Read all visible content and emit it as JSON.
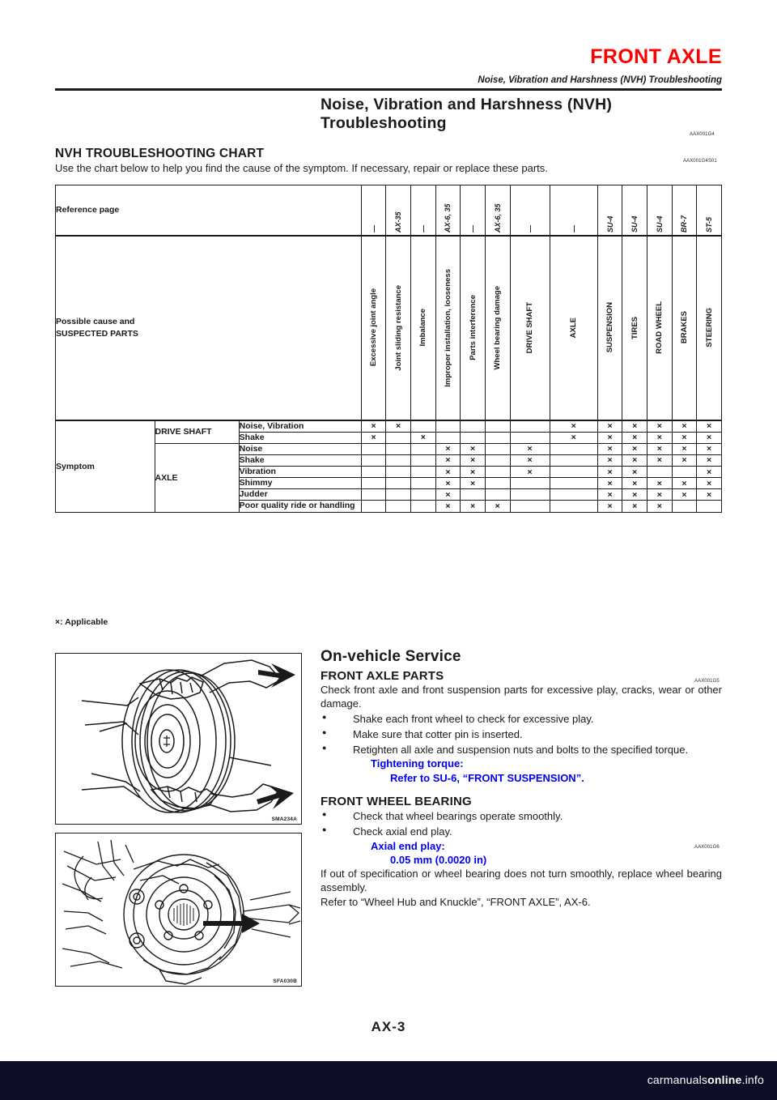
{
  "header": {
    "title": "FRONT AXLE",
    "subtitle": "Noise, Vibration and Harshness (NVH) Troubleshooting",
    "title_color": "#ff0000"
  },
  "section": {
    "title": "Noise, Vibration and Harshness (NVH) Troubleshooting",
    "code": "AAX001G4",
    "chart_heading": "NVH TROUBLESHOOTING CHART",
    "chart_code": "AAX001G4S01",
    "intro": "Use the chart below to help you find the cause of the symptom. If necessary, repair or replace these parts."
  },
  "nvh_table": {
    "reference_label": "Reference page",
    "cause_label_line1": "Possible cause and",
    "cause_label_line2": "SUSPECTED PARTS",
    "symptom_label": "Symptom",
    "applicable_note": "×: Applicable",
    "reference_pages": [
      "—",
      "AX-35",
      "—",
      "AX-6, 35",
      "—",
      "AX-6, 35",
      "—",
      "—",
      "SU-4",
      "SU-4",
      "SU-4",
      "BR-7",
      "ST-5"
    ],
    "columns": [
      "Excessive joint angle",
      "Joint sliding resistance",
      "Imbalance",
      "Improper installation, looseness",
      "Parts interference",
      "Wheel bearing damage",
      "DRIVE SHAFT",
      "AXLE",
      "SUSPENSION",
      "TIRES",
      "ROAD WHEEL",
      "BRAKES",
      "STEERING"
    ],
    "groups": [
      {
        "name": "DRIVE SHAFT",
        "rows": [
          {
            "symptom": "Noise, Vibration",
            "marks": [
              1,
              1,
              0,
              0,
              0,
              0,
              0,
              1,
              1,
              1,
              1,
              1,
              1
            ]
          },
          {
            "symptom": "Shake",
            "marks": [
              1,
              0,
              1,
              0,
              0,
              0,
              0,
              1,
              1,
              1,
              1,
              1,
              1
            ]
          }
        ]
      },
      {
        "name": "AXLE",
        "rows": [
          {
            "symptom": "Noise",
            "marks": [
              0,
              0,
              0,
              1,
              1,
              0,
              1,
              0,
              1,
              1,
              1,
              1,
              1
            ]
          },
          {
            "symptom": "Shake",
            "marks": [
              0,
              0,
              0,
              1,
              1,
              0,
              1,
              0,
              1,
              1,
              1,
              1,
              1
            ]
          },
          {
            "symptom": "Vibration",
            "marks": [
              0,
              0,
              0,
              1,
              1,
              0,
              1,
              0,
              1,
              1,
              0,
              0,
              1
            ]
          },
          {
            "symptom": "Shimmy",
            "marks": [
              0,
              0,
              0,
              1,
              1,
              0,
              0,
              0,
              1,
              1,
              1,
              1,
              1
            ]
          },
          {
            "symptom": "Judder",
            "marks": [
              0,
              0,
              0,
              1,
              0,
              0,
              0,
              0,
              1,
              1,
              1,
              1,
              1
            ]
          },
          {
            "symptom": "Poor quality ride or handling",
            "marks": [
              0,
              0,
              0,
              1,
              1,
              1,
              0,
              0,
              1,
              1,
              1,
              0,
              0
            ]
          }
        ]
      }
    ],
    "mark": "×"
  },
  "figures": [
    {
      "name": "shake-front-wheel-illustration",
      "code": "SMA234A"
    },
    {
      "name": "wheel-hub-knuckle-illustration",
      "code": "SFA030B"
    }
  ],
  "service": {
    "heading": "On-vehicle Service",
    "front_axle_parts": {
      "heading": "FRONT AXLE PARTS",
      "code": "AAX001G5",
      "paragraph": "Check front axle and front suspension parts for excessive play, cracks, wear or other damage.",
      "bullets": [
        "Shake each front wheel to check for excessive play.",
        "Make sure that cotter pin is inserted.",
        "Retighten all axle and suspension nuts and bolts to the specified torque."
      ],
      "spec_label": "Tightening torque:",
      "spec_value": "Refer to SU-6, “FRONT SUSPENSION”."
    },
    "front_wheel_bearing": {
      "heading": "FRONT WHEEL BEARING",
      "code": "AAX001G6",
      "bullets": [
        "Check that wheel bearings operate smoothly.",
        "Check axial end play."
      ],
      "spec_label": "Axial end play:",
      "spec_value": "0.05 mm (0.0020 in)",
      "closing1": "If out of specification or wheel bearing does not turn smoothly, replace wheel bearing assembly.",
      "closing2": "Refer to “Wheel Hub and Knuckle”, “FRONT AXLE”, AX-6."
    }
  },
  "page_number": "AX-3",
  "footer": {
    "watermark_light": "carmanuals",
    "watermark_bold": "online",
    "watermark_tld": ".info"
  }
}
